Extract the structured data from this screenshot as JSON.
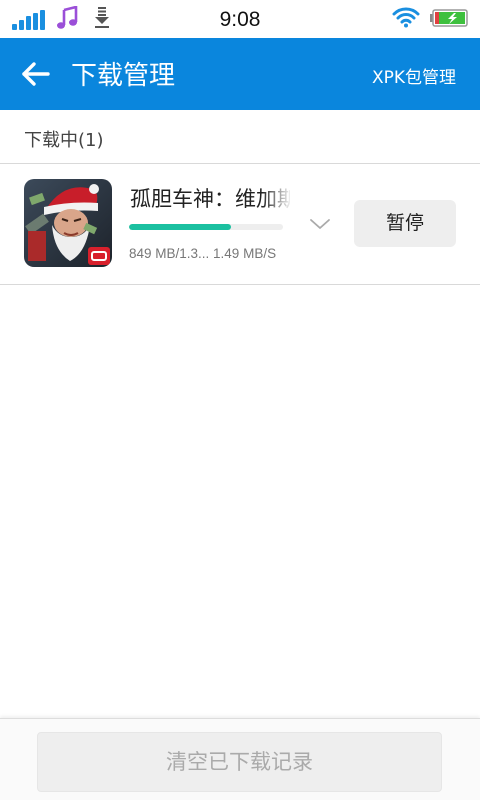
{
  "status_bar": {
    "time": "9:08",
    "icons": [
      "signal-icon",
      "music-icon",
      "download-notification-icon",
      "wifi-icon",
      "battery-charging-icon"
    ],
    "accent_color": "#1a8fe0"
  },
  "header": {
    "back_icon": "arrow-left-icon",
    "title": "下载管理",
    "action_label": "XPK包管理",
    "background_color": "#0a86dd"
  },
  "section": {
    "label": "下载中(1)"
  },
  "downloads": [
    {
      "name": "孤胆车神：维加斯",
      "progress_fraction": 0.66,
      "meta": "849 MB/1.3... 1.49 MB/S",
      "pause_label": "暂停",
      "expand_icon": "chevron-down-icon",
      "progress_color": "#1bc0a0"
    }
  ],
  "footer": {
    "clear_label": "清空已下载记录"
  }
}
